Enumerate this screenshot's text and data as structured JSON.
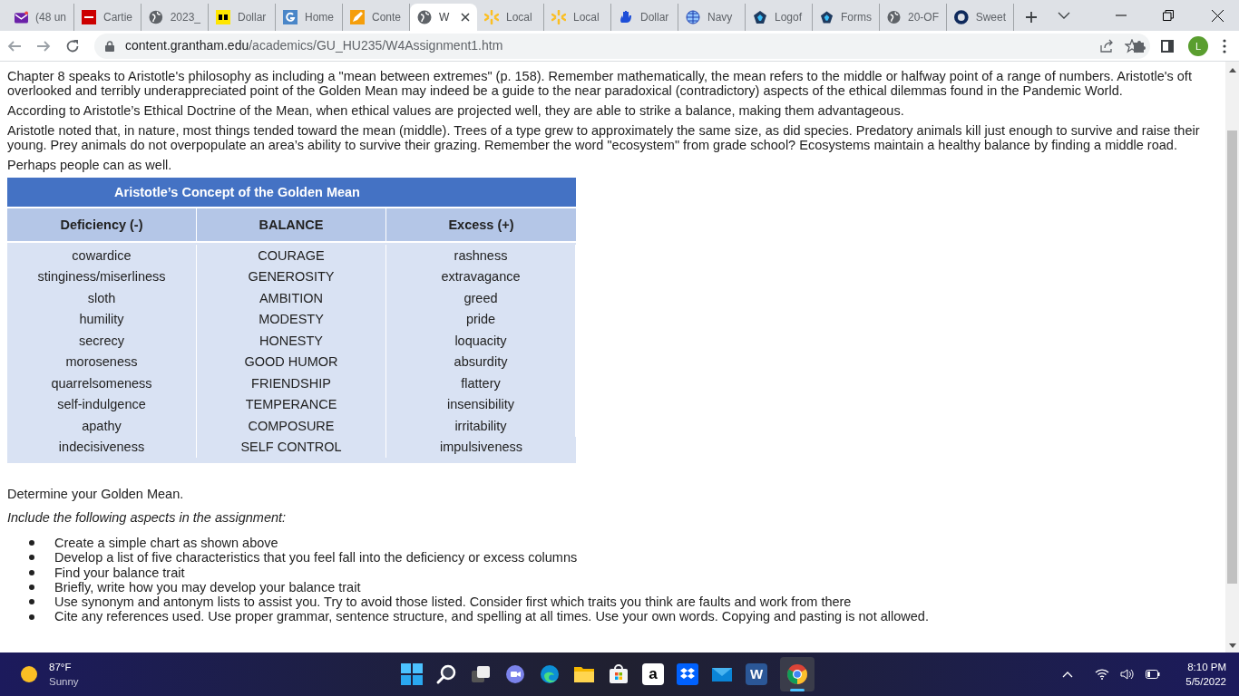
{
  "tabs": [
    {
      "label": "(48 un",
      "kind": "mail",
      "selected": false
    },
    {
      "label": "Cartie",
      "kind": "cwi",
      "selected": false
    },
    {
      "label": "2023_",
      "kind": "globe",
      "selected": false
    },
    {
      "label": "Dollar",
      "kind": "dg",
      "selected": false
    },
    {
      "label": "Home",
      "kind": "g",
      "selected": false
    },
    {
      "label": "Conte",
      "kind": "pencil",
      "selected": false
    },
    {
      "label": "W",
      "kind": "globe",
      "selected": true
    },
    {
      "label": "Local",
      "kind": "spark",
      "selected": false
    },
    {
      "label": "Local",
      "kind": "spark",
      "selected": false
    },
    {
      "label": "Dollar",
      "kind": "hand",
      "selected": false
    },
    {
      "label": "Navy",
      "kind": "web",
      "selected": false
    },
    {
      "label": "Logof",
      "kind": "pentagon",
      "selected": false
    },
    {
      "label": "Forms",
      "kind": "pentagon",
      "selected": false
    },
    {
      "label": "20-OF",
      "kind": "globe",
      "selected": false
    },
    {
      "label": "Sweet",
      "kind": "ring",
      "selected": false
    }
  ],
  "address": {
    "host": "content.grantham.edu",
    "path": "/academics/GU_HU235/W4Assignment1.htm"
  },
  "profile": {
    "initial": "L"
  },
  "paragraphs": [
    "Chapter 8 speaks to Aristotle's philosophy as including a \"mean between extremes\" (p. 158). Remember mathematically, the mean refers to the middle or halfway point of a range of numbers. Aristotle's oft overlooked and terribly underappreciated point of the Golden Mean may indeed be a guide to the near paradoxical (contradictory) aspects of the ethical dilemmas found in the Pandemic World.",
    "According to Aristotle’s Ethical Doctrine of the Mean, when ethical values are projected well, they are able to strike a balance, making them advantageous.",
    "Aristotle noted that, in nature, most things tended toward the mean (middle). Trees of a type grew to approximately the same size, as did species. Predatory animals kill just enough to survive and raise their young. Prey animals do not overpopulate an area’s ability to survive their grazing. Remember the word \"ecosystem\" from grade school? Ecosystems maintain a healthy balance by finding a middle road.",
    "Perhaps people can as well."
  ],
  "table": {
    "title": "Aristotle’s Concept of the Golden Mean",
    "columns": [
      "Deficiency (-)",
      "BALANCE",
      "Excess (+)"
    ],
    "rows": [
      [
        "cowardice",
        "COURAGE",
        "rashness"
      ],
      [
        "stinginess/miserliness",
        "GENEROSITY",
        "extravagance"
      ],
      [
        "sloth",
        "AMBITION",
        "greed"
      ],
      [
        "humility",
        "MODESTY",
        "pride"
      ],
      [
        "secrecy",
        "HONESTY",
        "loquacity"
      ],
      [
        "moroseness",
        "GOOD HUMOR",
        "absurdity"
      ],
      [
        "quarrelsomeness",
        "FRIENDSHIP",
        "flattery"
      ],
      [
        "self-indulgence",
        "TEMPERANCE",
        "insensibility"
      ],
      [
        "apathy",
        "COMPOSURE",
        "irritability"
      ],
      [
        "indecisiveness",
        "SELF CONTROL",
        "impulsiveness"
      ]
    ]
  },
  "instruction": "Determine your Golden Mean.",
  "aspects_intro": "Include the following aspects in the assignment:",
  "aspects": [
    "Create a simple chart as shown above",
    "Develop a list of five characteristics that you feel fall into the deficiency or excess columns",
    "Find your balance trait",
    "Briefly, write how you may develop your balance trait",
    "Use synonym and antonym lists to assist you. Try to avoid those listed. Consider first which traits you think are faults and work from there",
    "Cite any references used. Use proper grammar, sentence structure, and spelling at all times. Use your own words. Copying and pasting is not allowed."
  ],
  "taskbar": {
    "weather": {
      "temperature": "87°F",
      "condition": "Sunny"
    },
    "apps": [
      {
        "kind": "start"
      },
      {
        "kind": "search"
      },
      {
        "kind": "taskview"
      },
      {
        "kind": "chat"
      },
      {
        "kind": "edge"
      },
      {
        "kind": "folder"
      },
      {
        "kind": "store"
      },
      {
        "kind": "amazon",
        "glyph": "a"
      },
      {
        "kind": "dropbox"
      },
      {
        "kind": "mail"
      },
      {
        "kind": "word",
        "glyph": "W"
      },
      {
        "kind": "chrome"
      }
    ],
    "time": "8:10 PM",
    "date": "5/5/2022"
  }
}
